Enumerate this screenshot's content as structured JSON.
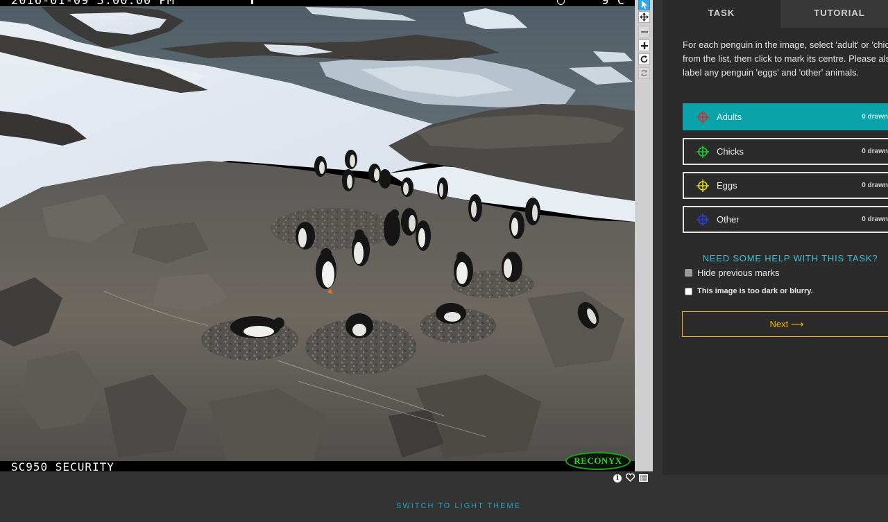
{
  "camera": {
    "timestamp": "2016-01-09 3:00:00 PM",
    "temperature": "9°C",
    "label": "SC950 SECURITY",
    "brand": "RECONYX"
  },
  "toolbar": {
    "tools": [
      "pointer-icon",
      "move-icon",
      "zoom-out-icon",
      "zoom-in-icon",
      "rotate-icon",
      "reset-icon"
    ]
  },
  "tabs": [
    {
      "label": "TASK"
    },
    {
      "label": "TUTORIAL"
    }
  ],
  "task": {
    "instructions": "For each penguin in the image, select 'adult' or 'chick' from the list, then click to mark its centre. Please also label any penguin 'eggs' and 'other' animals.",
    "options": [
      {
        "label": "Adults",
        "count": "0 drawn",
        "color": "#d62b2b"
      },
      {
        "label": "Chicks",
        "count": "0 drawn",
        "color": "#22c92e"
      },
      {
        "label": "Eggs",
        "count": "0 drawn",
        "color": "#e3d52b"
      },
      {
        "label": "Other",
        "count": "0 drawn",
        "color": "#2a3ed8"
      }
    ],
    "help_link": "NEED SOME HELP WITH THIS TASK?",
    "hide_marks_label": "Hide previous marks",
    "dark_blurry_label": "This image is too dark or blurry.",
    "next_label": "Next ⟶"
  },
  "footer": {
    "theme_link": "SWITCH TO LIGHT THEME"
  },
  "colors": {
    "accent": "#0aa3a9",
    "next": "#f0b400",
    "link": "#3ebfd6"
  }
}
